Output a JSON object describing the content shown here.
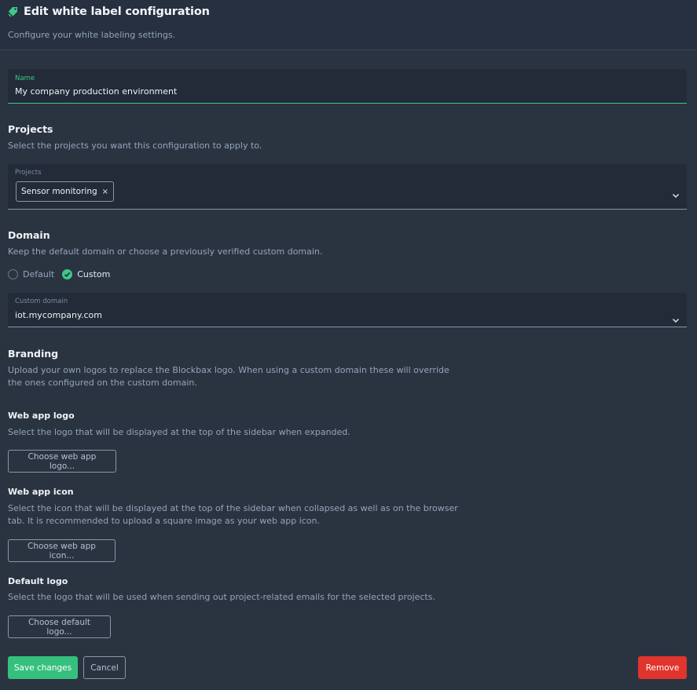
{
  "header": {
    "title": "Edit white label configuration",
    "subtitle": "Configure your white labeling settings."
  },
  "name_field": {
    "label": "Name",
    "value": "My company production environment"
  },
  "projects": {
    "title": "Projects",
    "description": "Select the projects you want this configuration to apply to.",
    "field_label": "Projects",
    "selected": [
      {
        "label": "Sensor monitoring",
        "remove": "×"
      }
    ]
  },
  "domain": {
    "title": "Domain",
    "description": "Keep the default domain or choose a previously verified custom domain.",
    "options": [
      {
        "label": "Default",
        "checked": false
      },
      {
        "label": "Custom",
        "checked": true
      }
    ],
    "field_label": "Custom domain",
    "value": "iot.mycompany.com"
  },
  "branding": {
    "title": "Branding",
    "description_line1": "Upload your own logos to replace the Blockbax logo. When using a custom domain these will override",
    "description_line2": "the ones configured on the custom domain.",
    "web_app_logo": {
      "title": "Web app logo",
      "description": "Select the logo that will be displayed at the top of the sidebar when expanded.",
      "button": "Choose web app logo..."
    },
    "web_app_icon": {
      "title": "Web app icon",
      "description_line1": "Select the icon that will be displayed at the top of the sidebar when collapsed as well as on the browser",
      "description_line2": "tab. It is recommended to upload a square image as your web app icon.",
      "button": "Choose web app icon..."
    },
    "default_logo": {
      "title": "Default logo",
      "description": "Select the logo that will be used when sending out project-related emails for the selected projects.",
      "button": "Choose default logo..."
    }
  },
  "footer": {
    "save": "Save changes",
    "cancel": "Cancel",
    "remove": "Remove"
  },
  "colors": {
    "accent": "#36c07d",
    "danger": "#e0342c",
    "background": "#2a3441",
    "field": "#222b37"
  },
  "icons": {
    "title": "tag-icon",
    "dropdown": "chevron-down-icon",
    "check": "check-icon"
  }
}
